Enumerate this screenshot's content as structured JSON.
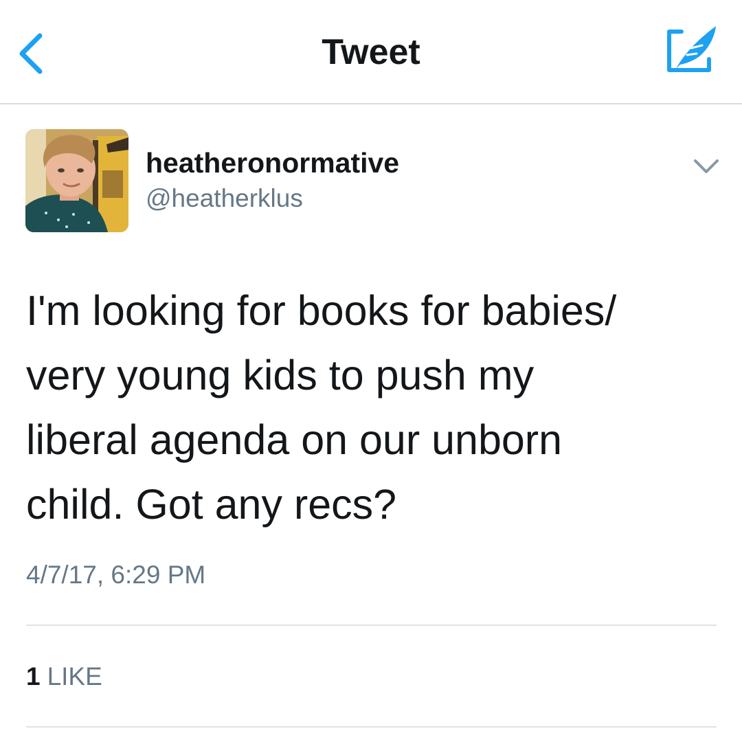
{
  "nav": {
    "title": "Tweet",
    "back_icon": "chevron-left-icon",
    "compose_icon": "compose-tweet-icon",
    "accent_color": "#1da1f2"
  },
  "tweet": {
    "author": {
      "display_name": "heatheronormative",
      "handle": "@heatherklus"
    },
    "text": "I'm looking for books for babies/\nvery young kids to push my\nliberal agenda on our unborn\nchild. Got any recs?",
    "timestamp": "4/7/17, 6:29 PM",
    "likes": {
      "count": "1",
      "label": "LIKE"
    }
  },
  "colors": {
    "text_primary": "#14171a",
    "text_secondary": "#657786",
    "divider": "#dfe3e7"
  }
}
